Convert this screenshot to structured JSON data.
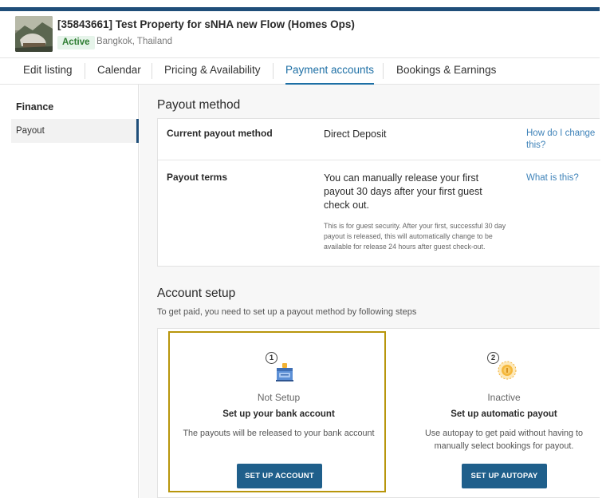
{
  "header": {
    "title": "[35843661] Test Property for sNHA new Flow (Homes Ops)",
    "status": "Active",
    "location": "Bangkok, Thailand",
    "accent_color": "#1f4e79"
  },
  "tabs": [
    {
      "label": "Edit listing",
      "active": false
    },
    {
      "label": "Calendar",
      "active": false
    },
    {
      "label": "Pricing & Availability",
      "active": false
    },
    {
      "label": "Payment accounts",
      "active": true
    },
    {
      "label": "Bookings & Earnings",
      "active": false
    }
  ],
  "sidebar": {
    "heading": "Finance",
    "items": [
      {
        "label": "Payout",
        "active": true
      }
    ]
  },
  "payout_method": {
    "title": "Payout method",
    "rows": [
      {
        "label": "Current payout method",
        "value": "Direct Deposit",
        "link": "How do I change this?"
      },
      {
        "label": "Payout terms",
        "value": "You can manually release your first payout 30 days after your first guest check out.",
        "note": "This is for guest security. After your first, successful 30 day payout is released, this will automatically change to be available for release 24 hours after guest check-out.",
        "link": "What is this?"
      }
    ]
  },
  "account_setup": {
    "title": "Account setup",
    "subtitle": "To get paid, you need to set up a payout method by following steps",
    "steps": [
      {
        "number": "1",
        "icon": "bank-icon",
        "status": "Not Setup",
        "title": "Set up your bank account",
        "description": "The payouts will be released to your bank account",
        "button": "SET UP ACCOUNT"
      },
      {
        "number": "2",
        "icon": "autopay-coin-icon",
        "status": "Inactive",
        "title": "Set up automatic payout",
        "description": "Use autopay to get paid without having to manually select bookings for payout.",
        "button": "SET UP AUTOPAY"
      }
    ],
    "highlight_color": "#b8960c",
    "button_color": "#1f5f8b",
    "link_color": "#3f83b9"
  }
}
